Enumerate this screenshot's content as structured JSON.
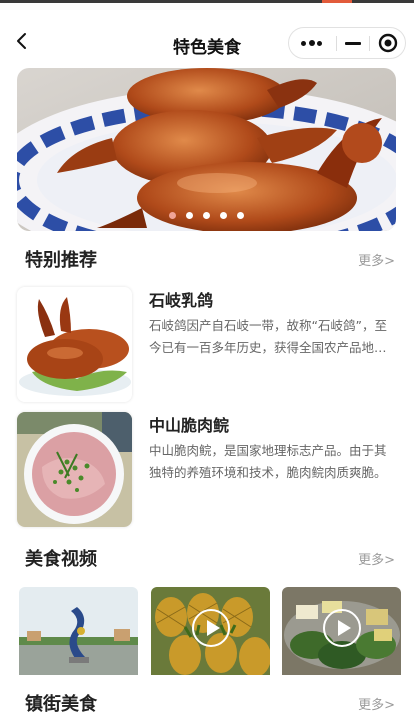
{
  "navbar": {
    "title": "特色美食",
    "back_icon": "chevron-left-icon",
    "capsule": {
      "more_icon": "more-dots-icon",
      "minimize_icon": "minimize-icon",
      "close_icon": "target-circle-icon"
    }
  },
  "banner": {
    "image": "roast-pigeons-on-blue-and-white-plate",
    "slide_count": 5,
    "active_slide": 1
  },
  "recommend": {
    "title": "特别推荐",
    "more": "更多>",
    "items": [
      {
        "name": "石岐乳鸽",
        "desc": "石岐鸽因产自石岐一带，故称“石岐鸽”，至今已有一百多年历史，获得全国农产品地理标志认证。",
        "image": "roast-pigeon"
      },
      {
        "name": "中山脆肉鲩",
        "desc": "中山脆肉鲩，是国家地理标志产品。由于其独特的养殖环境和技术，脆肉鲩肉质爽脆。",
        "image": "fish-slices-dish"
      }
    ]
  },
  "videos": {
    "title": "美食视频",
    "more": "更多>",
    "items": [
      {
        "image": "street-sculpture"
      },
      {
        "image": "pineapples",
        "play_icon": "play-icon"
      },
      {
        "image": "tofu-and-greens",
        "play_icon": "play-icon"
      }
    ]
  },
  "street": {
    "title": "镇街美食",
    "more": "更多>"
  },
  "colors": {
    "accent": "#e25b3b",
    "active_dot": "#f0a497",
    "more_text": "#9a9a9a"
  }
}
